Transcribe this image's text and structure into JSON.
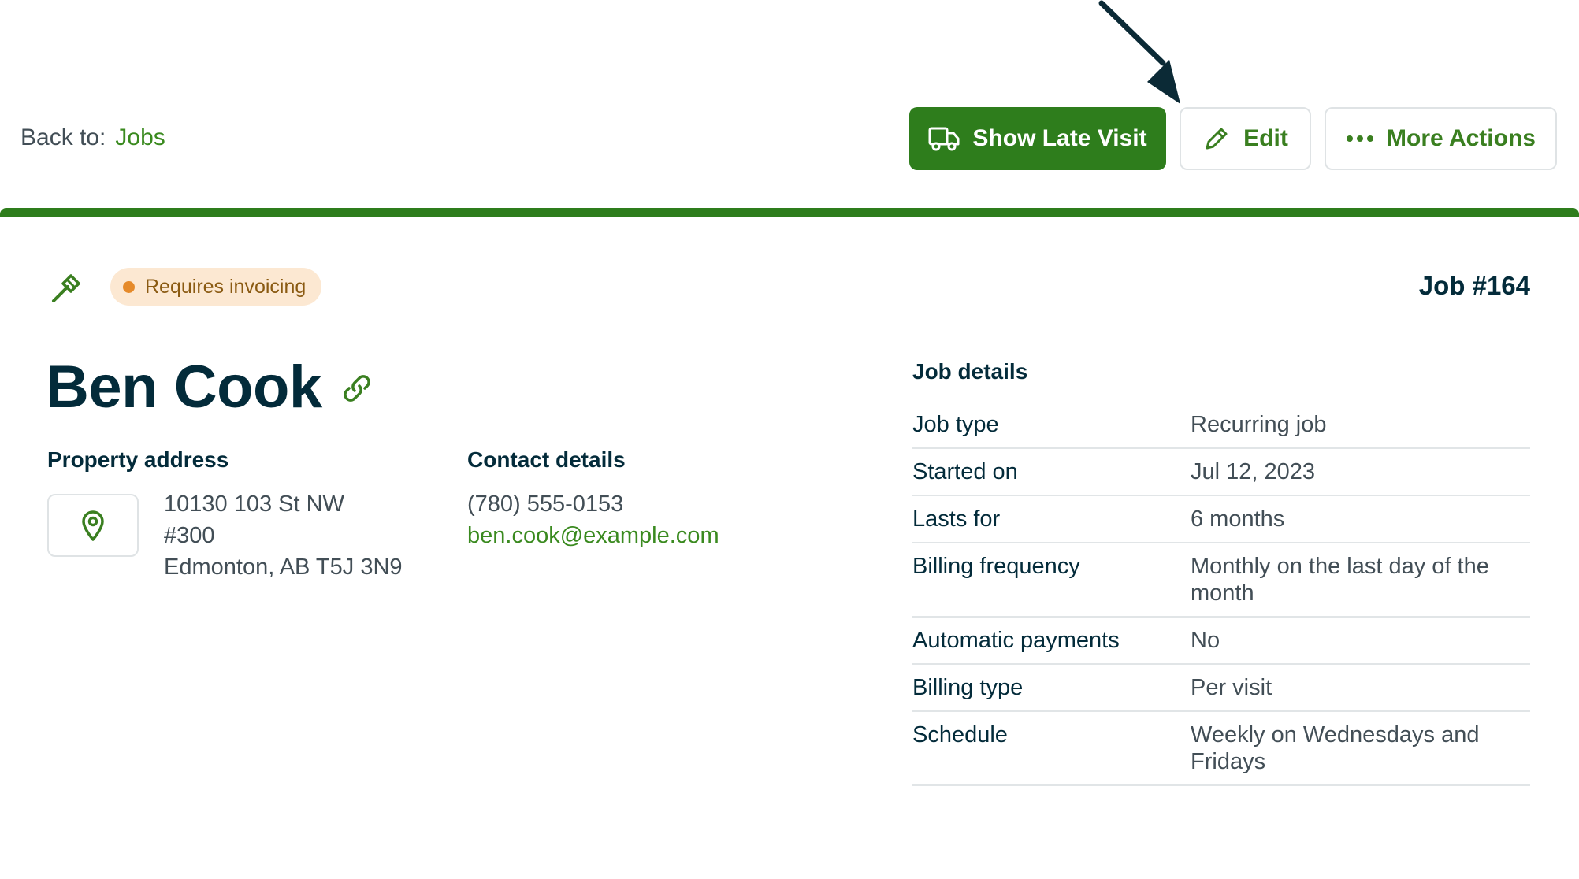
{
  "nav": {
    "back_label": "Back to:",
    "back_link": "Jobs"
  },
  "actions": {
    "show_late_visit": "Show Late Visit",
    "edit": "Edit",
    "more_actions": "More Actions"
  },
  "colors": {
    "brand": "#2e7d1c",
    "accent": "#3a8a1f",
    "badge_bg": "#fce8d2",
    "badge_dot": "#e58a2a",
    "text": "#032b3a"
  },
  "job": {
    "status_badge": "Requires invoicing",
    "number": "Job #164",
    "client_name": "Ben Cook"
  },
  "property": {
    "title": "Property address",
    "line1": "10130 103 St NW",
    "line2": "#300",
    "line3": "Edmonton, AB T5J 3N9"
  },
  "contact": {
    "title": "Contact details",
    "phone": "(780) 555-0153",
    "email": "ben.cook@example.com"
  },
  "details": {
    "title": "Job details",
    "rows": [
      {
        "label": "Job type",
        "value": "Recurring job"
      },
      {
        "label": "Started on",
        "value": "Jul 12, 2023"
      },
      {
        "label": "Lasts for",
        "value": "6 months"
      },
      {
        "label": "Billing frequency",
        "value": "Monthly on the last day of the month"
      },
      {
        "label": "Automatic payments",
        "value": "No"
      },
      {
        "label": "Billing type",
        "value": "Per visit"
      },
      {
        "label": "Schedule",
        "value": "Weekly on Wednesdays and Fridays"
      }
    ]
  },
  "icons": [
    "truck-icon",
    "pencil-icon",
    "more-dots-icon",
    "hammer-icon",
    "link-icon",
    "map-pin-icon",
    "annotation-arrow"
  ]
}
